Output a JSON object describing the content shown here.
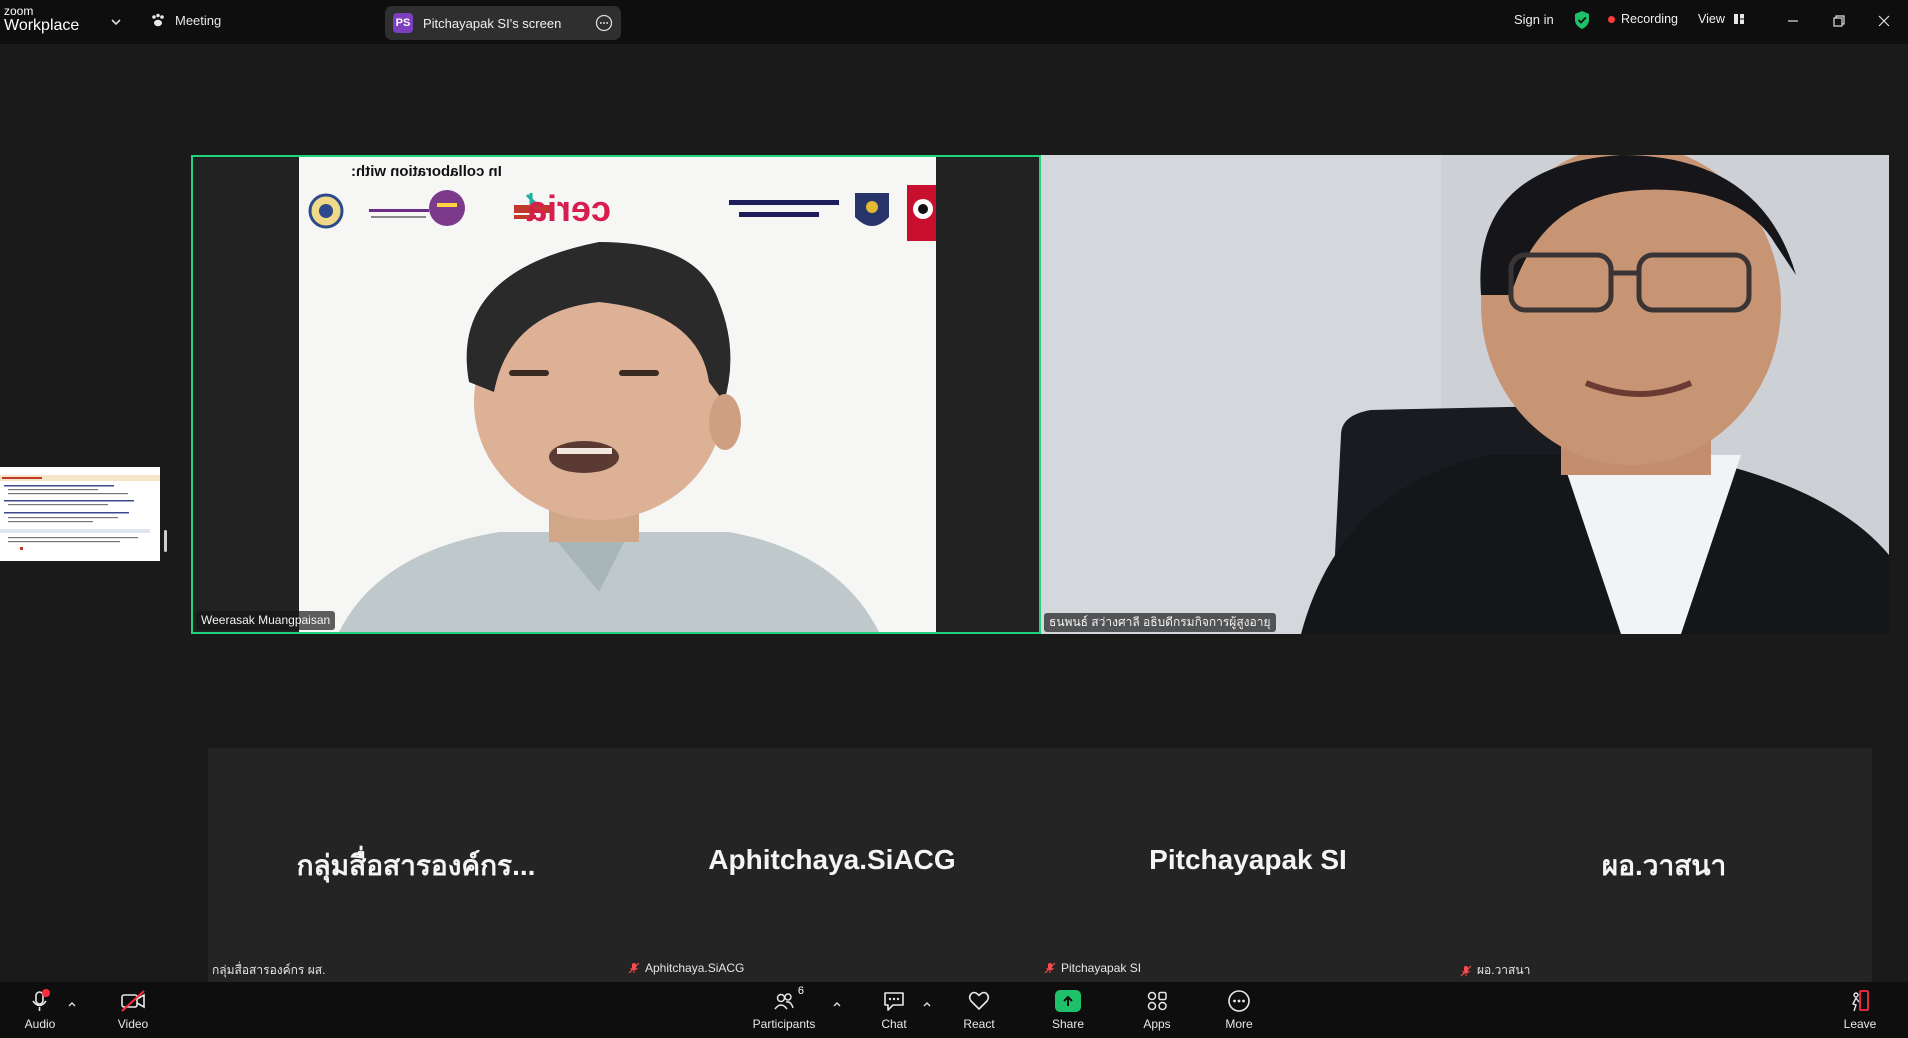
{
  "app": {
    "brand_top": "zoom",
    "brand_bottom": "Workplace",
    "meeting_label": "Meeting",
    "share_avatar": "PS",
    "share_label": "Pitchayapak SI's screen",
    "sign_in": "Sign in",
    "recording": "Recording",
    "view": "View"
  },
  "colors": {
    "active_border": "#22d37b",
    "recording_dot": "#ff3b3b",
    "share_green": "#1fc06a",
    "avatar_purple": "#7b3fbf"
  },
  "videos": {
    "active": {
      "name": "Weerasak Muangpaisan",
      "slide_text": "In collaboration with:"
    },
    "right": {
      "name": "ธนพนธ์ สว่างศาลี อธิบดีกรมกิจการผู้สูงอายุ"
    }
  },
  "participants": [
    {
      "display": "กลุ่มสื่อสารองค์กร...",
      "tag": "กลุ่มสื่อสารองค์กร ผส.",
      "muted": false
    },
    {
      "display": "Aphitchaya.SiACG",
      "tag": "Aphitchaya.SiACG",
      "muted": true
    },
    {
      "display": "Pitchayapak SI",
      "tag": "Pitchayapak SI",
      "muted": true
    },
    {
      "display": "ผอ.วาสนา",
      "tag": "ผอ.วาสนา",
      "muted": true
    }
  ],
  "toolbar": {
    "audio": "Audio",
    "video": "Video",
    "participants": "Participants",
    "participants_count": "6",
    "chat": "Chat",
    "react": "React",
    "share": "Share",
    "apps": "Apps",
    "more": "More",
    "leave": "Leave"
  }
}
